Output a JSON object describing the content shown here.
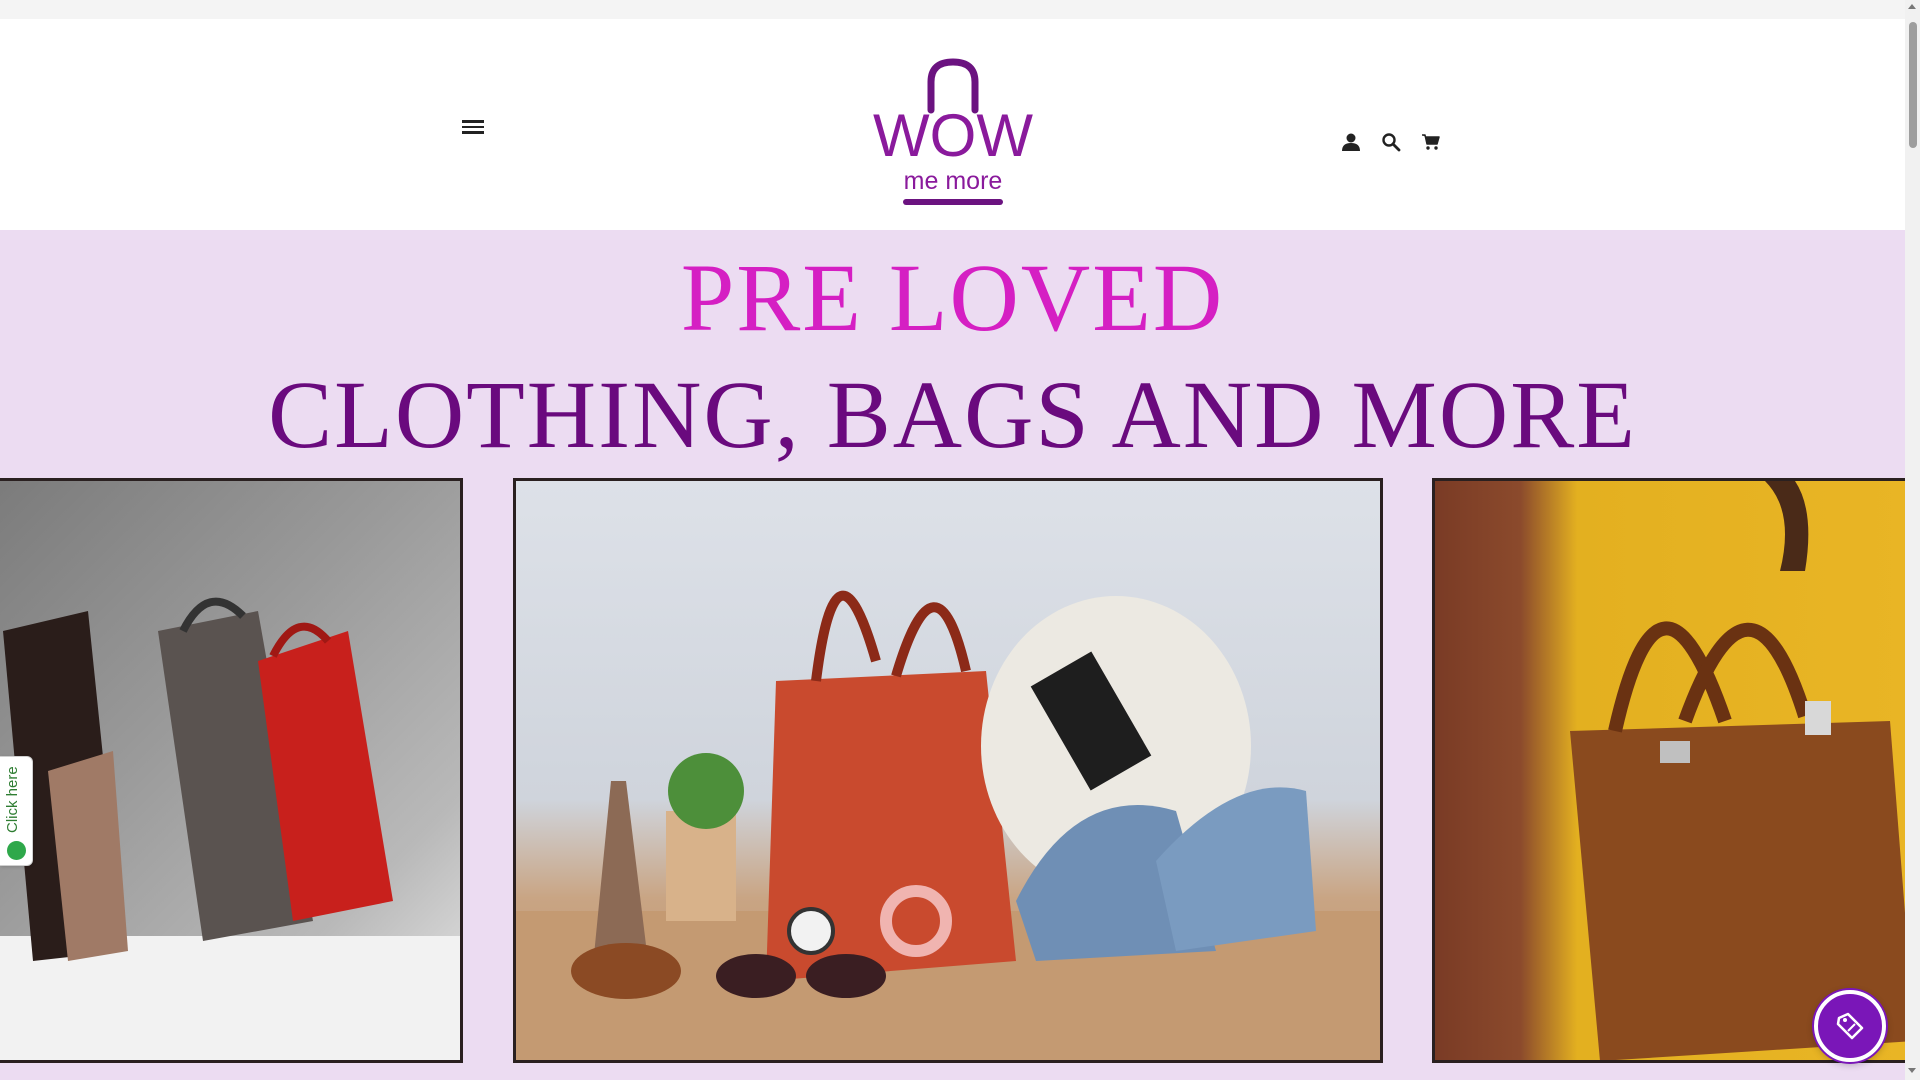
{
  "header": {
    "logo": {
      "word": "WOW",
      "sub": "me more",
      "color": "#8a1a9c"
    },
    "icons": [
      "hamburger-menu-icon",
      "account-icon",
      "search-icon",
      "cart-icon"
    ]
  },
  "hero": {
    "line1": "PRE LOVED",
    "line2": "CLOTHING, BAGS AND MORE",
    "colors": {
      "background": "#ecdcf2",
      "line1": "#d51fc3",
      "line2": "#6a0a7e"
    }
  },
  "whatsapp": {
    "label": "Click here",
    "icon": "whatsapp-icon"
  },
  "promo": {
    "icon": "discount-tag-icon"
  }
}
